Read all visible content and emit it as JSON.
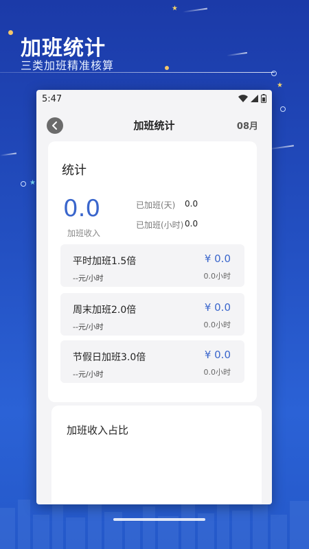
{
  "promo": {
    "title": "加班统计",
    "subtitle": "三类加班精准核算"
  },
  "status_bar": {
    "time": "5:47",
    "icons": [
      "wifi-icon",
      "signal-icon",
      "battery-icon"
    ]
  },
  "app_bar": {
    "title": "加班统计",
    "month": "08月",
    "back_icon": "chevron-left-icon"
  },
  "stats_card": {
    "title": "统计",
    "income_value": "0.0",
    "income_label": "加班收入",
    "days_label": "已加班(天)",
    "days_value": "0.0",
    "hours_label": "已加班(小时)",
    "hours_value": "0.0"
  },
  "rates": [
    {
      "name": "平时加班1.5倍",
      "amount": "¥ 0.0",
      "unit": "--元/小时",
      "hours": "0.0小时"
    },
    {
      "name": "周末加班2.0倍",
      "amount": "¥ 0.0",
      "unit": "--元/小时",
      "hours": "0.0小时"
    },
    {
      "name": "节假日加班3.0倍",
      "amount": "¥ 0.0",
      "unit": "--元/小时",
      "hours": "0.0小时"
    }
  ],
  "ratio_card": {
    "title": "加班收入占比"
  },
  "colors": {
    "accent": "#3a66cc",
    "background_top": "#1b3aa8",
    "background_bottom": "#2b62d6"
  }
}
